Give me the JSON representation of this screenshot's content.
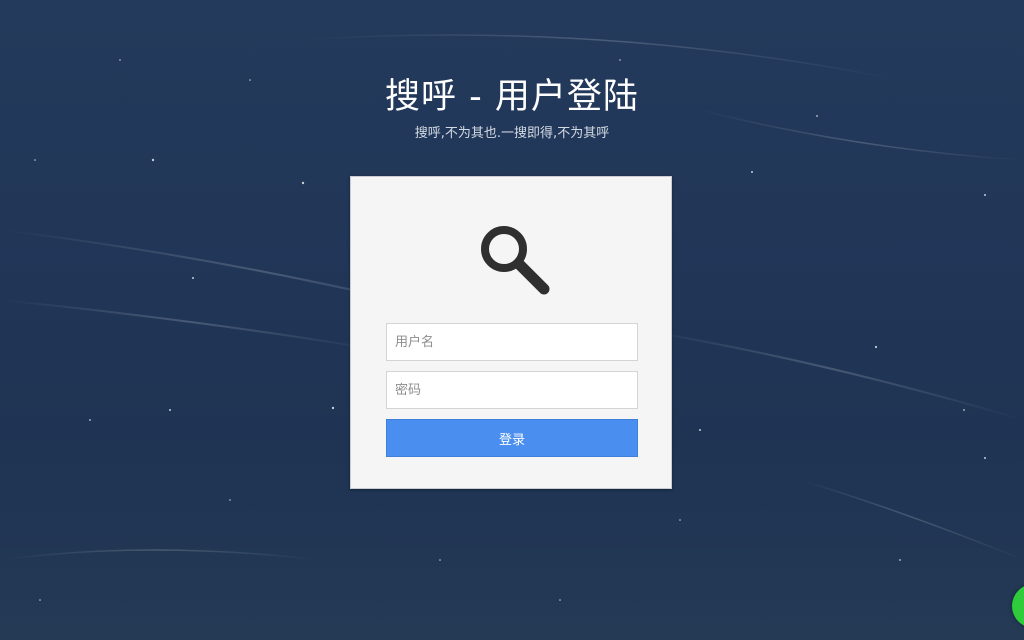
{
  "header": {
    "title": "搜呼 - 用户登陆",
    "subtitle": "搜呼,不为其也.一搜即得,不为其呼"
  },
  "login_form": {
    "logo_icon": "magnifier-icon",
    "username_placeholder": "用户名",
    "username_value": "",
    "password_placeholder": "密码",
    "password_value": "",
    "submit_label": "登录"
  },
  "colors": {
    "background": "#223858",
    "card": "#f5f5f5",
    "button": "#4a8ef0",
    "corner_badge": "#2ecc3a"
  }
}
